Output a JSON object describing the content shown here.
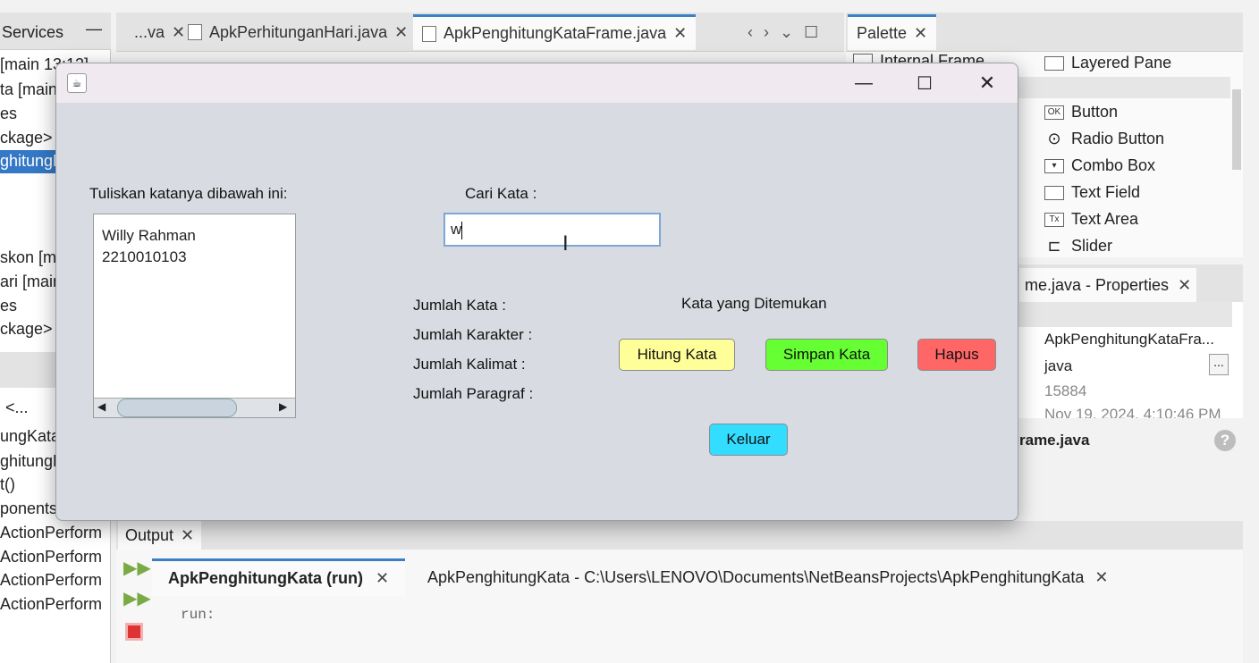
{
  "ide": {
    "services_tab": "Services",
    "editor_tabs": [
      {
        "label": "...va"
      },
      {
        "label": "ApkPerhitunganHari.java"
      },
      {
        "label": "ApkPenghitungKataFrame.java"
      }
    ],
    "palette_tab": "Palette",
    "left_lines": [
      "[main 13:12]",
      "ta [main]",
      "es",
      "ckage>",
      "ghitungK",
      "skon [ma",
      "ari [main",
      "es",
      "ckage>",
      "<...",
      "ungKatal",
      "ghitungKa",
      "t()",
      "ponents(",
      "ActionPerform",
      "ActionPerform",
      "ActionPerform",
      "ActionPerform"
    ],
    "palette_items": [
      "Internal Frame",
      "Layered Pane",
      "Button",
      "Radio Button",
      "Combo Box",
      "Text Field",
      "Text Area",
      "Slider"
    ],
    "properties_tab": "me.java - Properties",
    "properties_values": [
      "ApkPenghitungKataFra...",
      "java",
      "15884",
      "Nov 19, 2024, 4:10:46 PM"
    ],
    "properties_button": "...",
    "frame_java": "rame.java",
    "output_tab": "Output",
    "output_subtabs": [
      "ApkPenghitungKata (run)",
      "ApkPenghitungKata - C:\\Users\\LENOVO\\Documents\\NetBeansProjects\\ApkPenghitungKata"
    ],
    "output_text": "run:"
  },
  "app": {
    "prompt_label": "Tuliskan katanya dibawah ini:",
    "textarea_lines": [
      "Willy Rahman",
      "2210010103"
    ],
    "search_label": "Cari Kata :",
    "search_value": "w",
    "stats_labels": [
      "Jumlah Kata :",
      "Jumlah Karakter :",
      "Jumlah Kalimat :",
      "Jumlah Paragraf :"
    ],
    "found_label": "Kata yang Ditemukan",
    "buttons": {
      "hitung": "Hitung Kata",
      "simpan": "Simpan Kata",
      "hapus": "Hapus",
      "keluar": "Keluar"
    },
    "colors": {
      "hitung": "#ffff99",
      "simpan": "#66ff33",
      "hapus": "#ff6666",
      "keluar": "#33ddff"
    }
  }
}
